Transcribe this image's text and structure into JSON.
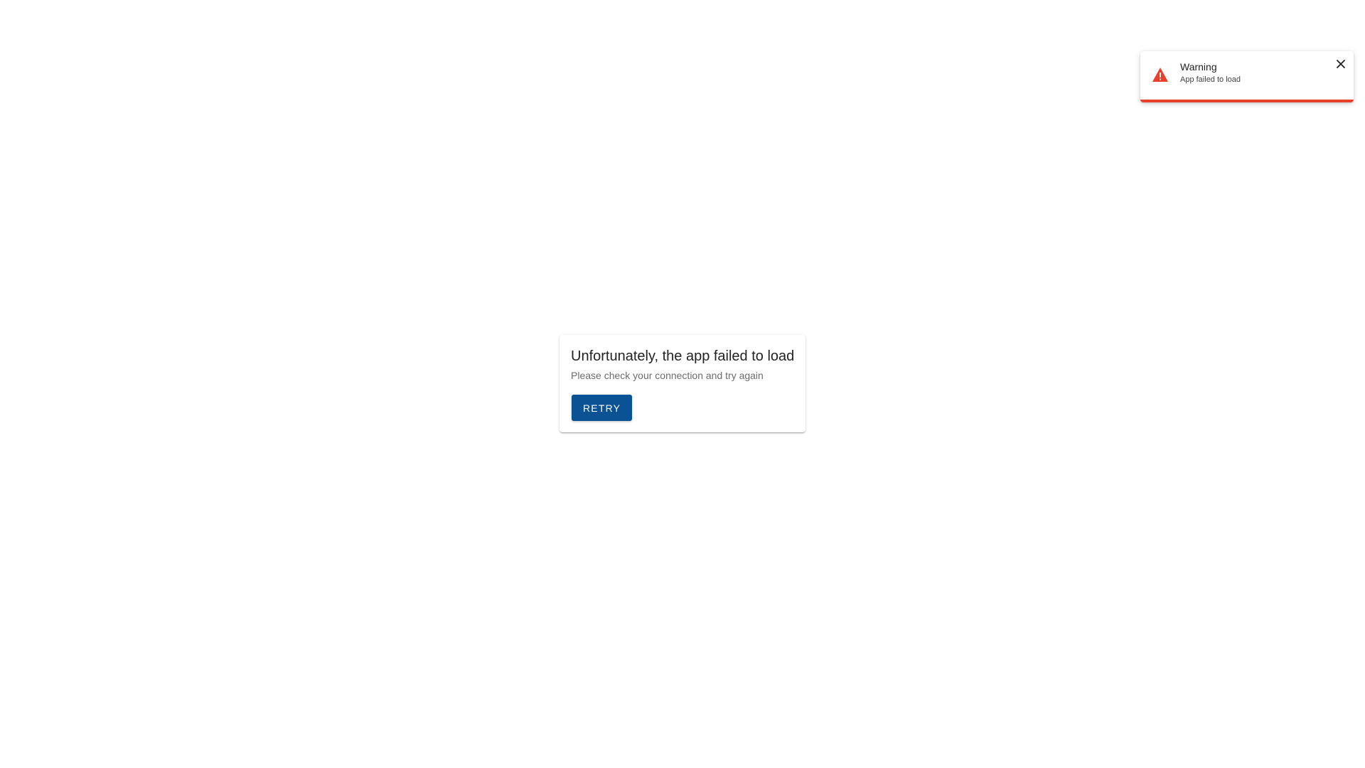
{
  "error_card": {
    "title": "Unfortunately, the app failed to load",
    "subtitle": "Please check your connection and try again",
    "retry_label": "RETRY"
  },
  "toast": {
    "title": "Warning",
    "message": "App failed to load",
    "icon": "warning-triangle-icon",
    "close_icon": "close-icon"
  },
  "colors": {
    "primary_button": "#0a5294",
    "warning_accent": "#e8402b",
    "background": "#ffffff"
  }
}
